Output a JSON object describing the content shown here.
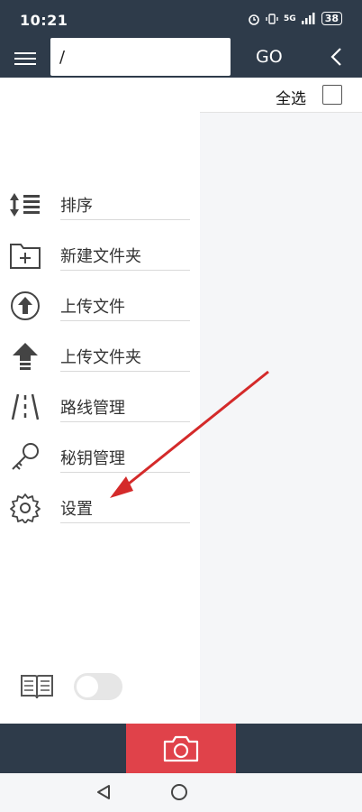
{
  "status_bar": {
    "time": "10:21",
    "network": "5G",
    "battery": "38"
  },
  "toolbar": {
    "path_value": "/",
    "go_label": "GO"
  },
  "content": {
    "select_all_label": "全选"
  },
  "drawer": {
    "items": [
      {
        "label": "排序",
        "icon": "sort-icon"
      },
      {
        "label": "新建文件夹",
        "icon": "new-folder-icon"
      },
      {
        "label": "上传文件",
        "icon": "upload-file-icon"
      },
      {
        "label": "上传文件夹",
        "icon": "upload-folder-icon"
      },
      {
        "label": "路线管理",
        "icon": "route-icon"
      },
      {
        "label": "秘钥管理",
        "icon": "key-icon"
      },
      {
        "label": "设置",
        "icon": "gear-icon"
      }
    ],
    "toggle_on": false
  },
  "colors": {
    "header": "#2e3b4a",
    "accent": "#e0424a",
    "arrow": "#d42a2a"
  }
}
